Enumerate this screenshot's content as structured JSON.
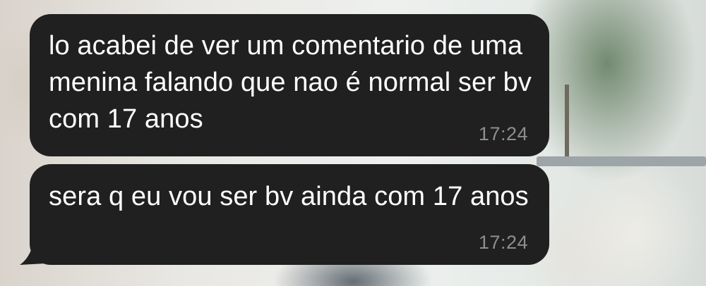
{
  "chat": {
    "messages": [
      {
        "text": "lo acabei de ver um comentario de uma menina falando que nao é normal ser bv com 17 anos",
        "time": "17:24"
      },
      {
        "text": "sera q eu vou ser bv ainda com 17 anos",
        "time": "17:24"
      }
    ]
  },
  "colors": {
    "bubble": "#202020",
    "text": "#ffffff",
    "timestamp": "#8e8e8e"
  }
}
